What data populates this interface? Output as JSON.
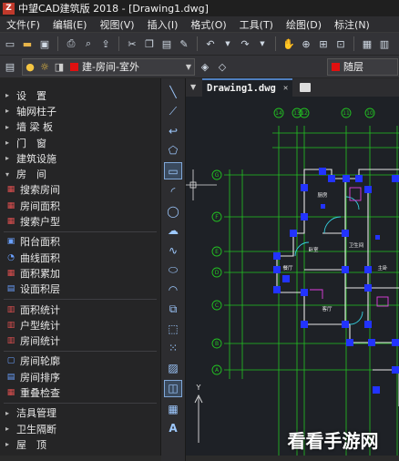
{
  "titlebar": {
    "title": "中望CAD建筑版  2018 - [Drawing1.dwg]",
    "app_icon_label": "Z"
  },
  "menubar": {
    "items": [
      "文件(F)",
      "编辑(E)",
      "视图(V)",
      "插入(I)",
      "格式(O)",
      "工具(T)",
      "绘图(D)",
      "标注(N)"
    ]
  },
  "toolbar2": {
    "layer_name": "建-房间-室外",
    "bylayer_label": "随层",
    "layer_color": "#e01010"
  },
  "sidepanel": {
    "sections": [
      {
        "label": "设　置",
        "type": "group"
      },
      {
        "label": "轴网柱子",
        "type": "group"
      },
      {
        "label": "墙 梁 板",
        "type": "group"
      },
      {
        "label": "门　窗",
        "type": "group"
      },
      {
        "label": "建筑设施",
        "type": "group"
      },
      {
        "label": "房　间",
        "type": "group-open"
      }
    ],
    "room_tools_1": [
      "搜索房间",
      "房间面积",
      "搜索户型"
    ],
    "room_tools_2": [
      "阳台面积",
      "曲线面积",
      "面积累加",
      "设面积层"
    ],
    "room_tools_3": [
      "面积统计",
      "户型统计",
      "房间统计"
    ],
    "room_tools_4": [
      "房间轮廓",
      "房间排序",
      "重叠检查"
    ],
    "trailing_groups": [
      "洁具管理",
      "卫生隔断",
      "屋　顶"
    ]
  },
  "drawing": {
    "tab_label": "Drawing1.dwg",
    "grid_top": [
      "14",
      "13",
      "12",
      "11",
      "10"
    ],
    "grid_left": [
      "G",
      "F",
      "E",
      "D",
      "C",
      "B",
      "A"
    ],
    "room_labels": [
      "厨房",
      "餐厅",
      "卧室",
      "卫生间",
      "客厅",
      "主卧"
    ],
    "ucs_y_label": "Y"
  },
  "watermark": {
    "text": "看看手游网"
  },
  "colors": {
    "grid_green": "#22c422",
    "wall_blue": "#2233ff",
    "accent": "#4f7fbf"
  }
}
